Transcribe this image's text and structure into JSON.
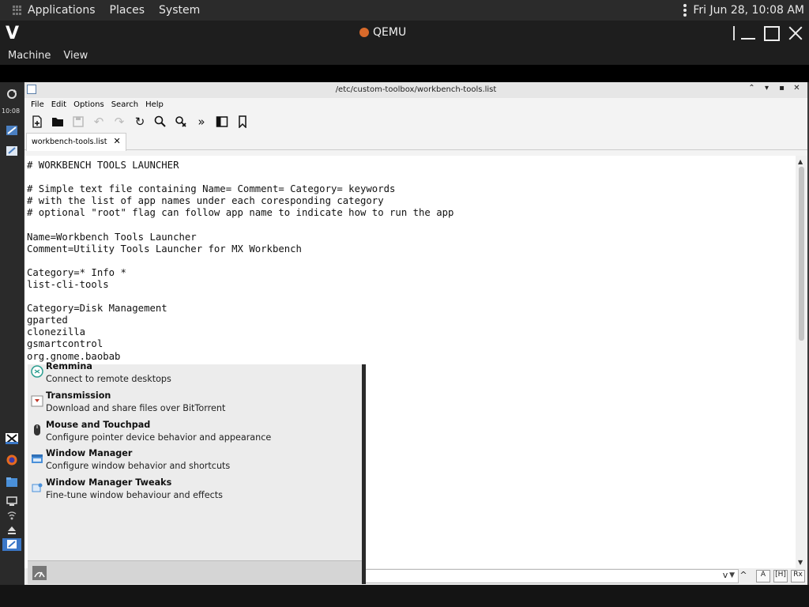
{
  "host_panel": {
    "menus": [
      "Applications",
      "Places",
      "System"
    ],
    "clock": "Fri Jun 28, 10:08 AM"
  },
  "qemu": {
    "title": "QEMU",
    "menu": [
      "Machine",
      "View"
    ]
  },
  "guest_panel": {
    "time": "10:08"
  },
  "editor": {
    "title": "/etc/custom-toolbox/workbench-tools.list",
    "menu": [
      "File",
      "Edit",
      "Options",
      "Search",
      "Help"
    ],
    "tab_label": "workbench-tools.list",
    "text": "# WORKBENCH TOOLS LAUNCHER\n\n# Simple text file containing Name= Comment= Category= keywords\n# with the list of app names under each coresponding category\n# optional \"root\" flag can follow app name to indicate how to run the app\n\nName=Workbench Tools Launcher\nComment=Utility Tools Launcher for MX Workbench\n\nCategory=* Info *\nlist-cli-tools\n\nCategory=Disk Management\ngparted\nclonezilla\ngsmartcontrol\norg.gnome.baobab",
    "findbar": {
      "search_value": "",
      "buttons": [
        "v",
        "^",
        "A",
        "[H]",
        "Rx"
      ]
    }
  },
  "start_menu": {
    "items": [
      {
        "name": "Remmina",
        "desc": "Connect to remote desktops",
        "icon": "remmina-icon"
      },
      {
        "name": "Transmission",
        "desc": "Download and share files over BitTorrent",
        "icon": "transmission-icon"
      },
      {
        "name": "Mouse and Touchpad",
        "desc": "Configure pointer device behavior and appearance",
        "icon": "mouse-icon"
      },
      {
        "name": "Window Manager",
        "desc": "Configure window behavior and shortcuts",
        "icon": "window-manager-icon"
      },
      {
        "name": "Window Manager Tweaks",
        "desc": "Fine-tune window behaviour and effects",
        "icon": "window-tweaks-icon"
      }
    ]
  },
  "colors": {
    "host_panel_bg": "#2b2b2b",
    "qemu_bg": "#1e1e1e",
    "editor_bg": "#ffffff",
    "menu_bg": "#ececec"
  }
}
